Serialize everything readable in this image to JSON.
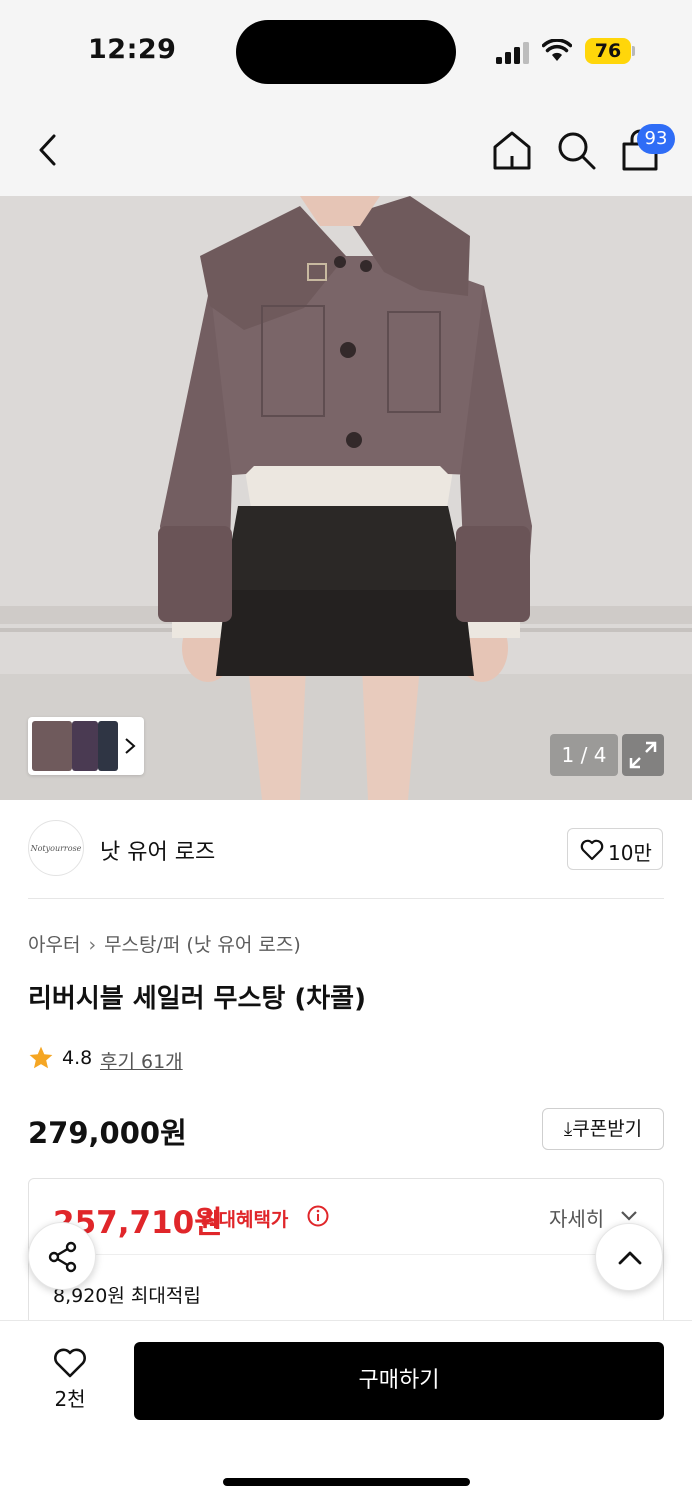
{
  "status_bar": {
    "time": "12:29",
    "battery": "76"
  },
  "nav": {
    "cart_count": "93"
  },
  "gallery": {
    "counter": "1 / 4",
    "icons": [
      "thumbnail-strip",
      "expand-icon"
    ]
  },
  "brand": {
    "name": "낫 유어 로즈",
    "logo_text": "Notyourrose",
    "likes": "10만"
  },
  "product": {
    "breadcrumb": [
      "아우터",
      "무스탕/퍼 (낫 유어 로즈)"
    ],
    "title": "리버시블 세일러 무스탕 (차콜)",
    "rating": "4.8",
    "reviews": "후기 61개",
    "price": "279,000원",
    "coupon_label": "쿠폰받기"
  },
  "benefit": {
    "price": "257,710원",
    "label": "최대혜택가",
    "detail_label": "자세히",
    "points": "8,920원 최대적립"
  },
  "bottom_bar": {
    "wish_count": "2천",
    "buy_label": "구매하기"
  },
  "colors": {
    "accent_red": "#e0262a",
    "badge_blue": "#2f6df6",
    "battery_yellow": "#ffd60a",
    "star": "#f5a623"
  }
}
